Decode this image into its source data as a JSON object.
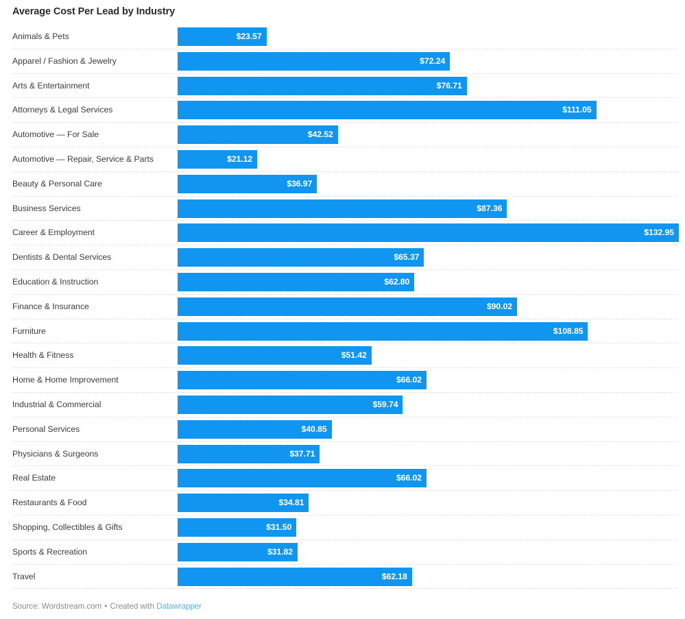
{
  "chart_data": {
    "type": "bar",
    "orientation": "horizontal",
    "title": "Average Cost Per Lead by Industry",
    "xlabel": "",
    "ylabel": "",
    "grid": false,
    "legend": null,
    "axis_visible": false,
    "value_prefix": "$",
    "xlim": [
      0,
      132.95
    ],
    "bar_color": "#1096f0",
    "value_label_color": "#ffffff",
    "categories": [
      "Animals & Pets",
      "Apparel / Fashion & Jewelry",
      "Arts & Entertainment",
      "Attorneys & Legal Services",
      "Automotive — For Sale",
      "Automotive — Repair, Service & Parts",
      "Beauty & Personal Care",
      "Business Services",
      "Career & Employment",
      "Dentists & Dental Services",
      "Education & Instruction",
      "Finance & Insurance",
      "Furniture",
      "Health & Fitness",
      "Home & Home Improvement",
      "Industrial & Commercial",
      "Personal Services",
      "Physicians & Surgeons",
      "Real Estate",
      "Restaurants & Food",
      "Shopping, Collectibles & Gifts",
      "Sports & Recreation",
      "Travel"
    ],
    "values": [
      23.57,
      72.24,
      76.71,
      111.05,
      42.52,
      21.12,
      36.97,
      87.36,
      132.95,
      65.37,
      62.8,
      90.02,
      108.85,
      51.42,
      66.02,
      59.74,
      40.85,
      37.71,
      66.02,
      34.81,
      31.5,
      31.82,
      62.18
    ],
    "value_labels": [
      "$23.57",
      "$72.24",
      "$76.71",
      "$111.05",
      "$42.52",
      "$21.12",
      "$36.97",
      "$87.36",
      "$132.95",
      "$65.37",
      "$62.80",
      "$90.02",
      "$108.85",
      "$51.42",
      "$66.02",
      "$59.74",
      "$40.85",
      "$37.71",
      "$66.02",
      "$34.81",
      "$31.50",
      "$31.82",
      "$62.18"
    ]
  },
  "footer": {
    "source_text": "Source: Wordstream.com",
    "separator": "•",
    "created_with": "Created with",
    "tool_name": "Datawrapper",
    "link_color": "#4fb3e8"
  }
}
